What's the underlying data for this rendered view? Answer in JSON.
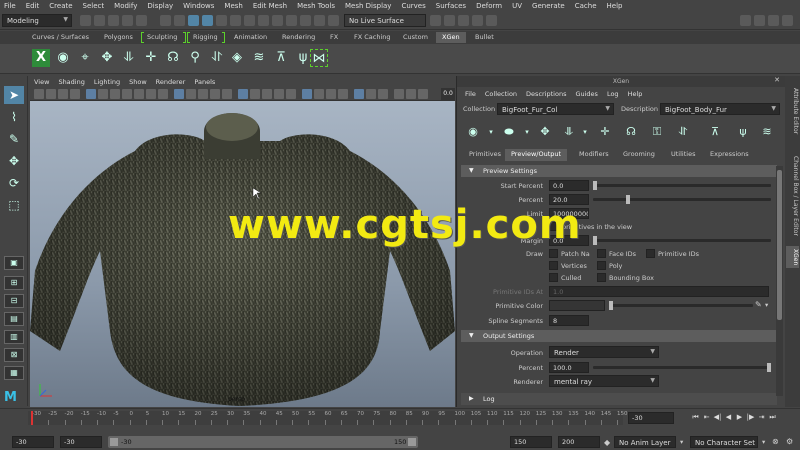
{
  "menubar": [
    "File",
    "Edit",
    "Create",
    "Select",
    "Modify",
    "Display",
    "Windows",
    "Mesh",
    "Edit Mesh",
    "Mesh Tools",
    "Mesh Display",
    "Curves",
    "Surfaces",
    "Deform",
    "UV",
    "Generate",
    "Cache",
    "Help"
  ],
  "statusline": {
    "mode": "Modeling",
    "live_surface": "No Live Surface"
  },
  "shelf_tabs": [
    "Curves / Surfaces",
    "Polygons",
    "Sculpting",
    "Rigging",
    "Animation",
    "Rendering",
    "FX",
    "FX Caching",
    "Custom",
    "XGen",
    "Bullet"
  ],
  "shelf_active": "XGen",
  "viewport": {
    "menu": [
      "View",
      "Shading",
      "Lighting",
      "Show",
      "Renderer",
      "Panels"
    ],
    "camera": "persp",
    "gamma_value": "0.0"
  },
  "watermark": "www.cgtsj.com",
  "xgen": {
    "title": "XGen",
    "menu": [
      "File",
      "Collection",
      "Descriptions",
      "Guides",
      "Log",
      "Help"
    ],
    "collection_label": "Collection",
    "collection_value": "BigFoot_Fur_Col",
    "description_label": "Description",
    "description_value": "BigFoot_Body_Fur",
    "tabs": [
      "Primitives",
      "Preview/Output",
      "Modifiers",
      "Grooming",
      "Utilities",
      "Expressions"
    ],
    "active_tab": "Preview/Output",
    "preview_section": "Preview Settings",
    "start_percent_label": "Start Percent",
    "start_percent": "0.0",
    "percent_label": "Percent",
    "percent": "20.0",
    "limit_label": "Limit",
    "limit": "100000000",
    "limit_note": "primitives in the view",
    "margin_label": "Margin",
    "margin": "0.0",
    "draw_label": "Draw",
    "draw_options": [
      "Patch Na",
      "Face IDs",
      "Primitive IDs",
      "Vertices",
      "Poly",
      "Culled",
      "Bounding Box"
    ],
    "prim_ids_at_label": "Primitive IDs At",
    "prim_ids_at": "1.0",
    "prim_color_label": "Primitive Color",
    "spline_segments_label": "Spline Segments",
    "spline_segments": "8",
    "output_section": "Output Settings",
    "operation_label": "Operation",
    "operation": "Render",
    "out_percent_label": "Percent",
    "out_percent": "100.0",
    "renderer_label": "Renderer",
    "renderer": "mental ray",
    "log_section": "Log"
  },
  "side_tabs": [
    "Attribute Editor",
    "Channel Box / Layer Editor",
    "XGen"
  ],
  "timeline": {
    "ticks": [
      "-30",
      "-25",
      "-20",
      "-15",
      "-10",
      "-5",
      "0",
      "5",
      "10",
      "15",
      "20",
      "25",
      "30",
      "35",
      "40",
      "45",
      "50",
      "55",
      "60",
      "65",
      "70",
      "75",
      "80",
      "85",
      "90",
      "95",
      "100",
      "105",
      "110",
      "115",
      "120",
      "125",
      "130",
      "135",
      "140",
      "145",
      "150"
    ],
    "current_frame": "-30"
  },
  "range": {
    "start": "-30",
    "playback_start": "-30",
    "range_start": "-30",
    "range_end": "150",
    "playback_end": "150",
    "end": "200",
    "anim_layer": "No Anim Layer",
    "character_set": "No Character Set"
  }
}
